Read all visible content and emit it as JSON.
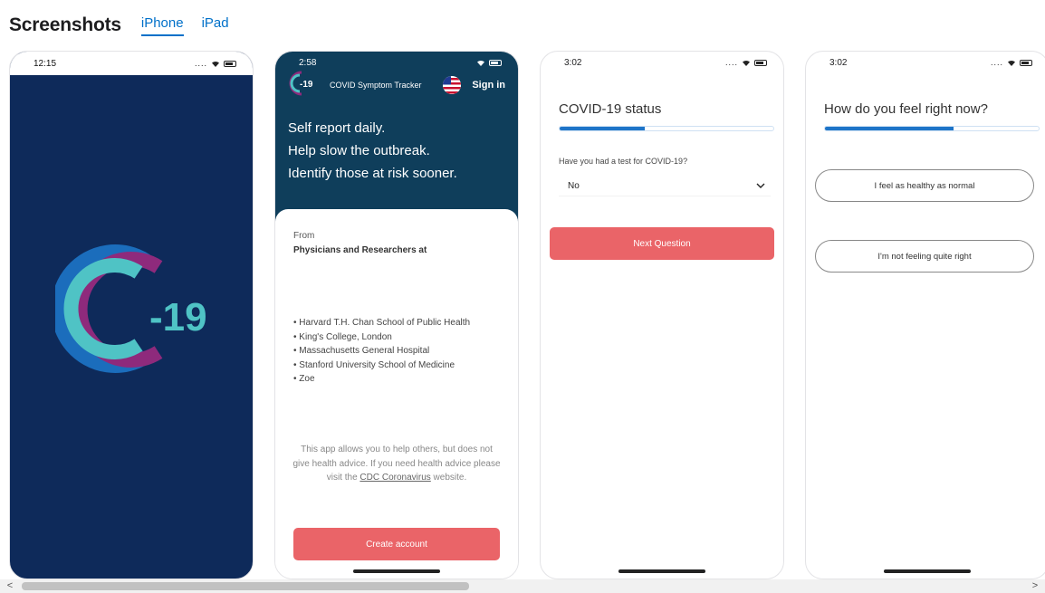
{
  "header": {
    "title": "Screenshots",
    "tabs": [
      {
        "label": "iPhone",
        "active": true
      },
      {
        "label": "iPad",
        "active": false
      }
    ]
  },
  "phone1": {
    "time": "12:15",
    "logo_text": "-19"
  },
  "phone2": {
    "time": "2:58",
    "app_name": "COVID Symptom Tracker",
    "logo_text": "-19",
    "signin": "Sign in",
    "tagline": [
      "Self report daily.",
      "Help slow the outbreak.",
      "Identify those at risk sooner."
    ],
    "from": "From",
    "physicians": "Physicians and Researchers at",
    "institutions": [
      "Harvard T.H. Chan School of Public Health",
      "King's College, London",
      "Massachusetts General Hospital",
      "Stanford University School of Medicine",
      "Zoe"
    ],
    "disclaimer_before": "This app allows you to help others, but does not give health advice. If you need health advice please visit the ",
    "disclaimer_link": "CDC Coronavirus",
    "disclaimer_after": " website.",
    "create_account": "Create account"
  },
  "phone3": {
    "time": "3:02",
    "title": "COVID-19 status",
    "progress": 0.4,
    "question": "Have you had a test for COVID-19?",
    "selected": "No",
    "next_button": "Next Question"
  },
  "phone4": {
    "time": "3:02",
    "title": "How do you feel right now?",
    "progress": 0.6,
    "option1": "I feel as healthy as normal",
    "option2": "I'm not feeling quite right"
  },
  "colors": {
    "accent": "#0070c9",
    "button": "#ea6468",
    "splash_bg": "#0e2a5a",
    "header_bg": "#0f3e5b",
    "progress": "#1e74c8",
    "logo_teal": "#4fc3c5",
    "logo_purple": "#8e2a7c"
  },
  "scroll": {
    "left_arrow": "<",
    "right_arrow": ">"
  }
}
